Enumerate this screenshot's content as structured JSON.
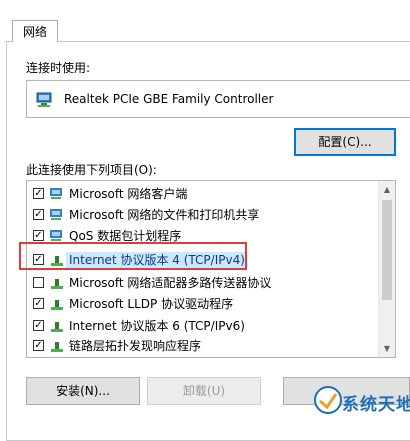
{
  "tab": {
    "label": "网络"
  },
  "connect_using": {
    "label": "连接时使用:",
    "device": "Realtek PCIe GBE Family Controller",
    "configure_button": "配置(C)..."
  },
  "items_section": {
    "label": "此连接使用下列项目(O):",
    "items": [
      {
        "label": "Microsoft 网络客户端",
        "checked": true,
        "icon": "network-client-icon"
      },
      {
        "label": "Microsoft 网络的文件和打印机共享",
        "checked": true,
        "icon": "file-printer-share-icon"
      },
      {
        "label": "QoS 数据包计划程序",
        "checked": true,
        "icon": "qos-scheduler-icon"
      },
      {
        "label": "Internet 协议版本 4 (TCP/IPv4)",
        "checked": true,
        "icon": "protocol-icon",
        "selected": true
      },
      {
        "label": "Microsoft 网络适配器多路传送器协议",
        "checked": false,
        "icon": "protocol-icon"
      },
      {
        "label": "Microsoft LLDP 协议驱动程序",
        "checked": true,
        "icon": "protocol-icon"
      },
      {
        "label": "Internet 协议版本 6 (TCP/IPv6)",
        "checked": true,
        "icon": "protocol-icon"
      },
      {
        "label": "链路层拓扑发现响应程序",
        "checked": true,
        "icon": "protocol-icon"
      }
    ]
  },
  "buttons": {
    "install": "安装(N)...",
    "uninstall": "卸载(U)"
  },
  "watermark": {
    "text": "系统天地"
  },
  "colors": {
    "highlight": "#e33b3b",
    "selection": "#cce8ff",
    "accent": "#0078d7"
  }
}
